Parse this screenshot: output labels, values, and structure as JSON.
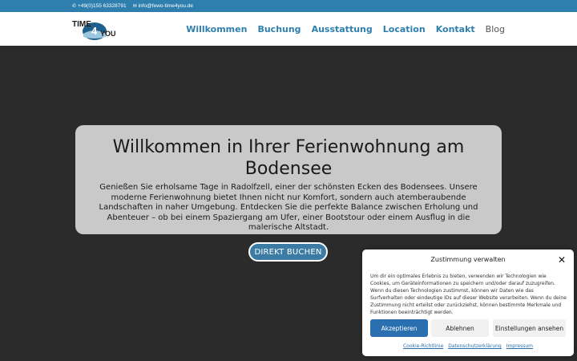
{
  "topbar": {
    "phone": "+49(0)155 63328791",
    "email": "info@fewo-time4you.de",
    "phone_icon": "phone-icon",
    "email_icon": "envelope-icon"
  },
  "logo": {
    "text_top": "TIME",
    "text_mid": "4",
    "text_end": "YOU"
  },
  "nav": {
    "items": [
      "Willkommen",
      "Buchung",
      "Ausstattung",
      "Location",
      "Kontakt",
      "Blog"
    ]
  },
  "hero": {
    "title": "Willkommen in Ihrer Ferienwohnung am Bodensee",
    "body": "Genießen Sie erholsame Tage in Radolfzell, einer der schönsten Ecken des Bodensees. Unsere moderne Ferienwohnung bietet Ihnen nicht nur Komfort, sondern auch atemberaubende Landschaften in naher Umgebung. Entdecken Sie die perfekte Balance zwischen Erholung und Abenteuer – ob bei einem Spaziergang am Ufer, einer Bootstour oder einem Ausflug in die malerische Altstadt.",
    "cta": "DIREKT BUCHEN"
  },
  "consent": {
    "title": "Zustimmung verwalten",
    "text": "Um dir ein optimales Erlebnis zu bieten, verwenden wir Technologien wie Cookies, um Geräteinformationen zu speichern und/oder darauf zuzugreifen. Wenn du diesen Technologien zustimmst, können wir Daten wie das Surfverhalten oder eindeutige IDs auf dieser Website verarbeiten. Wenn du deine Zustimmung nicht erteilst oder zurückziehst, können bestimmte Merkmale und Funktionen beeinträchtigt werden.",
    "accept": "Akzeptieren",
    "deny": "Ablehnen",
    "settings": "Einstellungen ansehen",
    "links": [
      "Cookie-Richtlinie",
      "Datenschutzerklärung",
      "Impressum"
    ]
  },
  "colors": {
    "brand": "#2e7fae",
    "hero_bg": "#2b2b2b",
    "card_bg": "#c9c9c9",
    "accept_btn": "#2a6fb0"
  }
}
